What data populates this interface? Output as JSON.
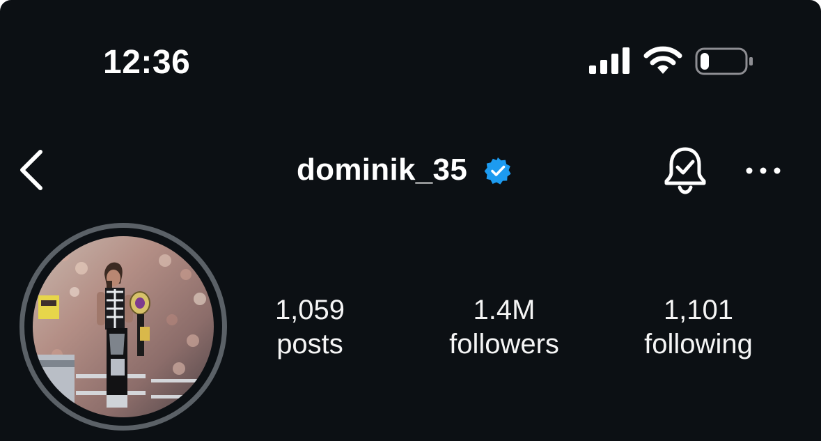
{
  "status_bar": {
    "time": "12:36",
    "signal_icon": "cellular-signal-icon",
    "wifi_icon": "wifi-icon",
    "battery_icon": "battery-icon",
    "battery_level": 0.2
  },
  "header": {
    "back_icon": "chevron-left-icon",
    "username": "dominik_35",
    "verified_icon": "verified-badge-icon",
    "verified_color": "#1d9bf0",
    "notifications_icon": "bell-check-icon",
    "more_icon": "more-horizontal-icon"
  },
  "profile": {
    "avatar": "profile-photo",
    "stats": [
      {
        "value": "1,059",
        "label": "posts"
      },
      {
        "value": "1.4M",
        "label": "followers"
      },
      {
        "value": "1,101",
        "label": "following"
      }
    ]
  },
  "colors": {
    "background": "#0c1014",
    "text": "#f5f5f5",
    "avatar_ring": "#5b6167"
  }
}
